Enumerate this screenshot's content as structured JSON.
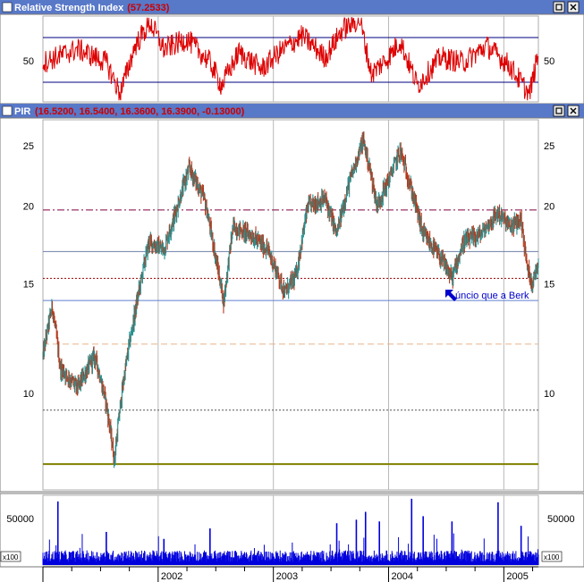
{
  "colors": {
    "titlebar_bg": "#5878c8",
    "titlebar_text": "#ffffff",
    "titlebar_value": "#cc0000",
    "panel_border": "#7a7a7a",
    "rsi_line": "#dd0000",
    "rsi_bands": "#000080",
    "price_up": "#2a8f8f",
    "price_down": "#b23a1c",
    "volume_bar": "#0000dd",
    "grid_vertical": "#b9b9b9",
    "annotation_text": "#0000cc",
    "resistance_line": "#800040",
    "mid_line": "#6f7fa8",
    "support_dotted": "#990000",
    "support_solid": "#5f7fcf",
    "fib_dashed": "#e8b38a",
    "low_dotted": "#555555",
    "base_line": "#808000"
  },
  "rsi_panel": {
    "indicator_name": "Relative Strength Index",
    "value_text": "(57.2533)",
    "y_tick_label": "50"
  },
  "price_panel": {
    "symbol": "PIR",
    "values_text": "(16.5200, 16.5400, 16.3600, 16.3900, -0.13000)",
    "annotation": "úncio que a Berk",
    "annotation_icon": "arrow-northwest-icon"
  },
  "volume_panel": {
    "y_tick_label": "50000",
    "multiplier_label": "x100"
  },
  "window_icons": [
    "restore-window-icon",
    "close-window-icon"
  ],
  "chart_data": [
    {
      "type": "line",
      "name": "Relative Strength Index",
      "x_range": [
        2001.0,
        2005.3
      ],
      "ylim": [
        28,
        80
      ],
      "y_ticks": [
        50
      ],
      "bands": [
        30,
        70
      ],
      "key_points": [
        {
          "x": 2001.0,
          "y": 52
        },
        {
          "x": 2001.3,
          "y": 60
        },
        {
          "x": 2001.55,
          "y": 52
        },
        {
          "x": 2001.67,
          "y": 33
        },
        {
          "x": 2001.8,
          "y": 62
        },
        {
          "x": 2001.93,
          "y": 76
        },
        {
          "x": 2002.05,
          "y": 60
        },
        {
          "x": 2002.25,
          "y": 66
        },
        {
          "x": 2002.45,
          "y": 52
        },
        {
          "x": 2002.55,
          "y": 38
        },
        {
          "x": 2002.7,
          "y": 58
        },
        {
          "x": 2002.9,
          "y": 48
        },
        {
          "x": 2003.05,
          "y": 58
        },
        {
          "x": 2003.25,
          "y": 68
        },
        {
          "x": 2003.45,
          "y": 55
        },
        {
          "x": 2003.6,
          "y": 72
        },
        {
          "x": 2003.75,
          "y": 78
        },
        {
          "x": 2003.85,
          "y": 45
        },
        {
          "x": 2004.0,
          "y": 55
        },
        {
          "x": 2004.1,
          "y": 65
        },
        {
          "x": 2004.25,
          "y": 38
        },
        {
          "x": 2004.45,
          "y": 55
        },
        {
          "x": 2004.65,
          "y": 52
        },
        {
          "x": 2004.85,
          "y": 62
        },
        {
          "x": 2005.05,
          "y": 50
        },
        {
          "x": 2005.15,
          "y": 40
        },
        {
          "x": 2005.22,
          "y": 32
        },
        {
          "x": 2005.3,
          "y": 57
        }
      ]
    },
    {
      "type": "candlestick",
      "name": "PIR",
      "x_range": [
        2001.0,
        2005.3
      ],
      "ylim": [
        7.0,
        27.5
      ],
      "y_ticks": [
        10,
        15,
        20,
        25
      ],
      "y_scale": "log",
      "x_ticks": [
        {
          "value": 2002,
          "label": "2002"
        },
        {
          "value": 2003,
          "label": "2003"
        },
        {
          "value": 2004,
          "label": "2004"
        },
        {
          "value": 2005,
          "label": "2005"
        }
      ],
      "horizontal_levels": [
        {
          "value": 19.7,
          "style": "dash-dot",
          "color": "#800040"
        },
        {
          "value": 16.9,
          "style": "solid",
          "color": "#6f7fa8"
        },
        {
          "value": 15.3,
          "style": "dotted",
          "color": "#990000"
        },
        {
          "value": 14.1,
          "style": "solid",
          "color": "#5f7fcf"
        },
        {
          "value": 12.0,
          "style": "dashed",
          "color": "#e8b38a"
        },
        {
          "value": 9.4,
          "style": "dotted",
          "color": "#555555"
        },
        {
          "value": 7.7,
          "style": "solid",
          "color": "#808000"
        }
      ],
      "key_points": [
        {
          "x": 2001.0,
          "y": 11.5
        },
        {
          "x": 2001.08,
          "y": 13.8
        },
        {
          "x": 2001.15,
          "y": 11.0
        },
        {
          "x": 2001.3,
          "y": 10.2
        },
        {
          "x": 2001.45,
          "y": 11.5
        },
        {
          "x": 2001.55,
          "y": 9.6
        },
        {
          "x": 2001.62,
          "y": 7.8
        },
        {
          "x": 2001.7,
          "y": 10.5
        },
        {
          "x": 2001.8,
          "y": 13.5
        },
        {
          "x": 2001.92,
          "y": 17.5
        },
        {
          "x": 2002.05,
          "y": 17.0
        },
        {
          "x": 2002.15,
          "y": 19.5
        },
        {
          "x": 2002.27,
          "y": 23.0
        },
        {
          "x": 2002.4,
          "y": 20.5
        },
        {
          "x": 2002.5,
          "y": 16.5
        },
        {
          "x": 2002.57,
          "y": 14.0
        },
        {
          "x": 2002.65,
          "y": 18.5
        },
        {
          "x": 2002.8,
          "y": 18.0
        },
        {
          "x": 2002.95,
          "y": 17.0
        },
        {
          "x": 2003.1,
          "y": 14.5
        },
        {
          "x": 2003.2,
          "y": 15.5
        },
        {
          "x": 2003.3,
          "y": 20.0
        },
        {
          "x": 2003.45,
          "y": 20.5
        },
        {
          "x": 2003.55,
          "y": 18.0
        },
        {
          "x": 2003.65,
          "y": 21.5
        },
        {
          "x": 2003.78,
          "y": 25.5
        },
        {
          "x": 2003.9,
          "y": 20.0
        },
        {
          "x": 2004.0,
          "y": 22.0
        },
        {
          "x": 2004.1,
          "y": 24.5
        },
        {
          "x": 2004.22,
          "y": 20.5
        },
        {
          "x": 2004.3,
          "y": 18.0
        },
        {
          "x": 2004.45,
          "y": 16.5
        },
        {
          "x": 2004.55,
          "y": 15.3
        },
        {
          "x": 2004.65,
          "y": 17.5
        },
        {
          "x": 2004.8,
          "y": 18.0
        },
        {
          "x": 2004.95,
          "y": 19.5
        },
        {
          "x": 2005.05,
          "y": 18.5
        },
        {
          "x": 2005.15,
          "y": 19.0
        },
        {
          "x": 2005.2,
          "y": 16.0
        },
        {
          "x": 2005.25,
          "y": 15.0
        },
        {
          "x": 2005.3,
          "y": 16.39
        }
      ]
    },
    {
      "type": "bar",
      "name": "Volume",
      "x_range": [
        2001.0,
        2005.3
      ],
      "ylim": [
        0,
        80000
      ],
      "y_ticks": [
        50000
      ],
      "typical_value": 12000,
      "spikes": [
        {
          "x": 2001.13,
          "y": 73000
        },
        {
          "x": 2001.55,
          "y": 38000
        },
        {
          "x": 2002.05,
          "y": 30000
        },
        {
          "x": 2002.45,
          "y": 42000
        },
        {
          "x": 2003.55,
          "y": 48000
        },
        {
          "x": 2003.72,
          "y": 52000
        },
        {
          "x": 2003.8,
          "y": 61000
        },
        {
          "x": 2003.92,
          "y": 50000
        },
        {
          "x": 2004.2,
          "y": 76000
        },
        {
          "x": 2004.3,
          "y": 56000
        },
        {
          "x": 2004.55,
          "y": 50000
        },
        {
          "x": 2004.95,
          "y": 72000
        },
        {
          "x": 2005.15,
          "y": 45000
        }
      ]
    }
  ]
}
